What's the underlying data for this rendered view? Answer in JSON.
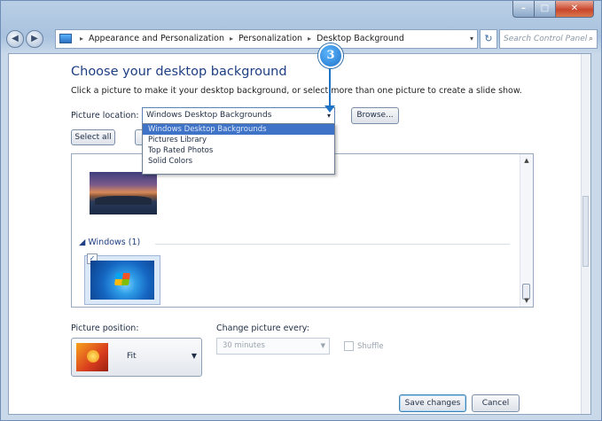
{
  "window": {
    "buttons": {
      "minimize": "–",
      "maximize": "□",
      "close": "✕"
    }
  },
  "nav": {
    "back_icon": "◀",
    "forward_icon": "▶",
    "breadcrumb": [
      "Appearance and Personalization",
      "Personalization",
      "Desktop Background"
    ],
    "breadcrumb_sep": "▸",
    "address_arrow": "▾",
    "refresh_icon": "↻",
    "search_placeholder": "Search Control Panel",
    "search_icon": "⌕"
  },
  "main": {
    "heading": "Choose your desktop background",
    "description": "Click a picture to make it your desktop background, or select more than one picture to create a slide show.",
    "picture_location_label": "Picture location:",
    "picture_location_value": "Windows Desktop Backgrounds",
    "browse_label": "Browse...",
    "select_all_label": "Select all",
    "dropdown_options": [
      "Windows Desktop Backgrounds",
      "Pictures Library",
      "Top Rated Photos",
      "Solid Colors"
    ],
    "group_label": "Windows (1)",
    "group_chevron": "◢",
    "picture_position_label": "Picture position:",
    "picture_position_value": "Fit",
    "change_picture_label": "Change picture every:",
    "interval_value": "30 minutes",
    "shuffle_label": "Shuffle",
    "save_label": "Save changes",
    "cancel_label": "Cancel",
    "checkmark": "✓"
  },
  "callout": {
    "number": "3"
  },
  "colors": {
    "accent": "#1f73c7",
    "heading": "#1e3f83",
    "selection": "#3f73c8"
  }
}
